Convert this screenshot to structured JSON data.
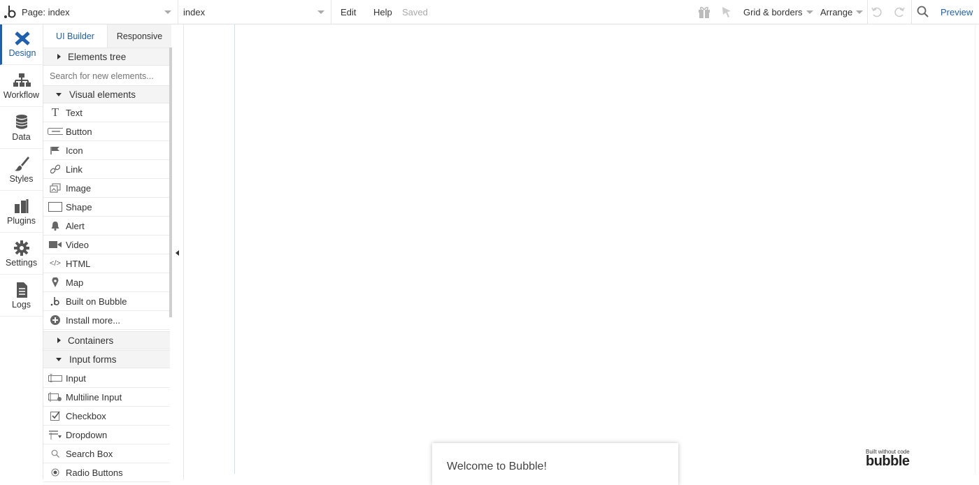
{
  "topbar": {
    "logo": "b",
    "page_label": "Page: index",
    "page_select": "index",
    "edit": "Edit",
    "help": "Help",
    "saved": "Saved",
    "grid_borders": "Grid & borders",
    "arrange": "Arrange",
    "preview": "Preview"
  },
  "nav": {
    "items": [
      {
        "label": "Design",
        "icon": "design-icon"
      },
      {
        "label": "Workflow",
        "icon": "workflow-icon"
      },
      {
        "label": "Data",
        "icon": "database-icon"
      },
      {
        "label": "Styles",
        "icon": "brush-icon"
      },
      {
        "label": "Plugins",
        "icon": "plugins-icon"
      },
      {
        "label": "Settings",
        "icon": "gear-icon"
      },
      {
        "label": "Logs",
        "icon": "document-icon"
      }
    ]
  },
  "panel": {
    "tabs": [
      "UI Builder",
      "Responsive"
    ],
    "elements_tree": "Elements tree",
    "search_placeholder": "Search for new elements...",
    "visual_elements": "Visual elements",
    "visual_items": [
      {
        "label": "Text",
        "icon": "text-icon"
      },
      {
        "label": "Button",
        "icon": "button-icon"
      },
      {
        "label": "Icon",
        "icon": "flag-icon"
      },
      {
        "label": "Link",
        "icon": "link-icon"
      },
      {
        "label": "Image",
        "icon": "image-icon"
      },
      {
        "label": "Shape",
        "icon": "shape-icon"
      },
      {
        "label": "Alert",
        "icon": "bell-icon"
      },
      {
        "label": "Video",
        "icon": "video-icon"
      },
      {
        "label": "HTML",
        "icon": "code-icon"
      },
      {
        "label": "Map",
        "icon": "map-pin-icon"
      },
      {
        "label": "Built on Bubble",
        "icon": "bubble-logo-icon"
      },
      {
        "label": "Install more...",
        "icon": "plus-circle-icon"
      }
    ],
    "containers": "Containers",
    "input_forms": "Input forms",
    "input_items": [
      {
        "label": "Input",
        "icon": "input-icon"
      },
      {
        "label": "Multiline Input",
        "icon": "multiline-input-icon"
      },
      {
        "label": "Checkbox",
        "icon": "checkbox-icon"
      },
      {
        "label": "Dropdown",
        "icon": "dropdown-icon"
      },
      {
        "label": "Search Box",
        "icon": "search-icon"
      },
      {
        "label": "Radio Buttons",
        "icon": "radio-icon"
      }
    ]
  },
  "canvas": {
    "welcome": "Welcome to Bubble!",
    "built_small": "Built without code",
    "built_big": "bubble"
  }
}
